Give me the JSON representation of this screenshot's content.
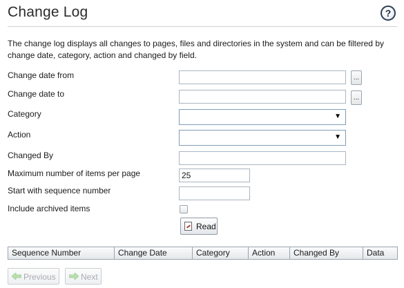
{
  "header": {
    "title": "Change Log",
    "help_glyph": "?"
  },
  "intro": "The change log displays all changes to pages, files and directories in the system and can be filtered by change date, category, action and changed by field.",
  "form": {
    "change_date_from_label": "Change date from",
    "change_date_from_value": "",
    "change_date_to_label": "Change date to",
    "change_date_to_value": "",
    "date_picker_glyph": "...",
    "category_label": "Category",
    "category_value": "",
    "action_label": "Action",
    "action_value": "",
    "changed_by_label": "Changed By",
    "changed_by_value": "",
    "max_items_label": "Maximum number of items per page",
    "max_items_value": "25",
    "start_sequence_label": "Start with sequence number",
    "start_sequence_value": "",
    "include_archived_label": "Include archived items",
    "include_archived_checked": false,
    "read_label": "Read"
  },
  "table": {
    "columns": [
      "Sequence Number",
      "Change Date",
      "Category",
      "Action",
      "Changed By",
      "Data"
    ]
  },
  "pager": {
    "previous_label": "Previous",
    "next_label": "Next"
  },
  "colors": {
    "pager_arrow_disabled": "#b9e0b0",
    "rule": "#cfcfcf"
  }
}
